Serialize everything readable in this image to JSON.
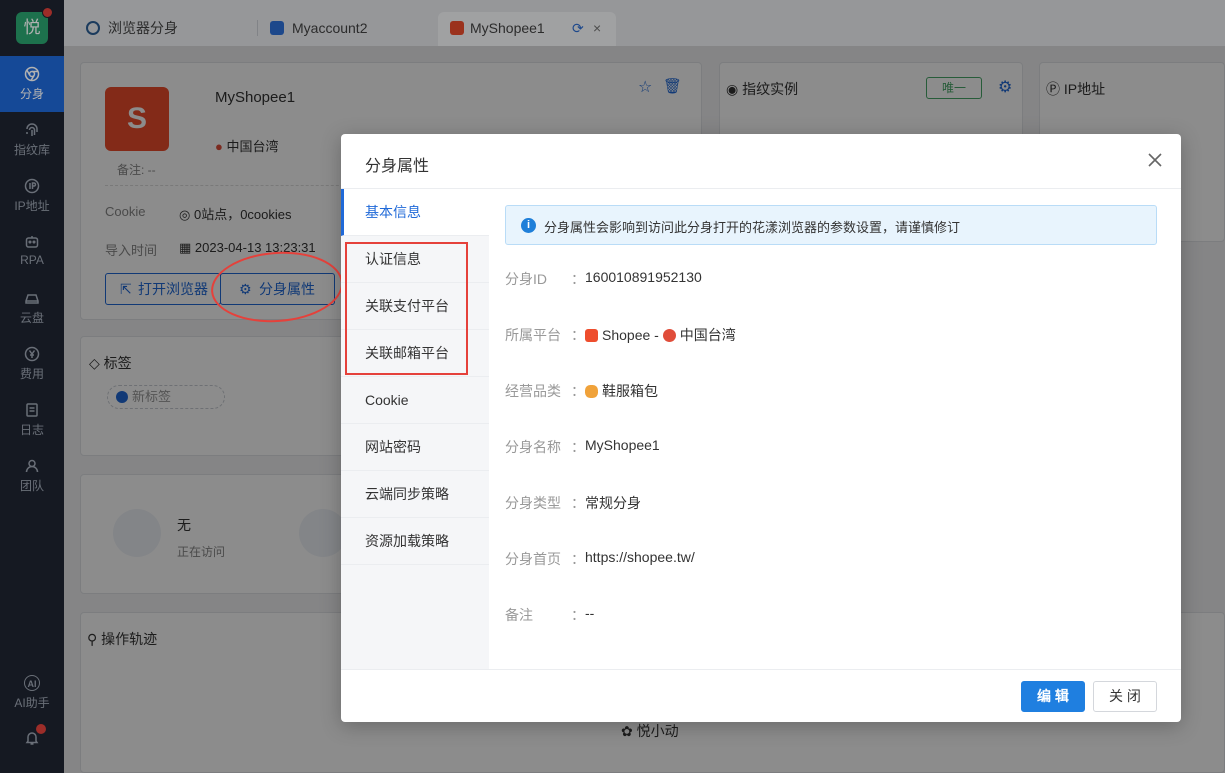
{
  "sidebar": {
    "logo": "悦",
    "items": [
      {
        "label": "分身",
        "icon": "chrome-icon"
      },
      {
        "label": "指纹库",
        "icon": "fingerprint-icon"
      },
      {
        "label": "IP地址",
        "icon": "ip-icon"
      },
      {
        "label": "RPA",
        "icon": "robot-icon"
      },
      {
        "label": "云盘",
        "icon": "cloud-drive-icon"
      },
      {
        "label": "费用",
        "icon": "yen-icon"
      },
      {
        "label": "日志",
        "icon": "log-icon"
      },
      {
        "label": "团队",
        "icon": "team-icon"
      }
    ],
    "ai_label": "AI助手",
    "ai_badge": "AI"
  },
  "tabs": [
    {
      "label": "浏览器分身",
      "icon": "chrome-icon"
    },
    {
      "label": "Myaccount2",
      "icon": "dots-icon"
    },
    {
      "label": "MyShopee1",
      "icon": "shopee-icon"
    }
  ],
  "profile": {
    "name": "MyShopee1",
    "logo_letter": "S",
    "region": "中国台湾",
    "remark": "备注: --",
    "cookie_label": "Cookie",
    "cookie_value": "0站点，0cookies",
    "import_label": "导入时间",
    "import_value": "2023-04-13 13:23:31",
    "open_browser": "打开浏览器",
    "attributes": "分身属性"
  },
  "cards": {
    "fingerprint": "指纹实例",
    "fingerprint_badge": "唯一",
    "ip": "IP地址",
    "tags": "标签",
    "new_tag": "新标签",
    "visitor": "无",
    "visiting": "正在访问",
    "trace": "操作轨迹",
    "assistant": "悦小动"
  },
  "modal": {
    "title": "分身属性",
    "menu": [
      "基本信息",
      "认证信息",
      "关联支付平台",
      "关联邮箱平台",
      "Cookie",
      "网站密码",
      "云端同步策略",
      "资源加载策略"
    ],
    "notice": "分身属性会影响到访问此分身打开的花漾浏览器的参数设置，请谨慎修订",
    "fields": {
      "id_label": "分身ID",
      "id_value": "160010891952130",
      "platform_label": "所属平台",
      "platform_name": "Shopee",
      "platform_sep": "-",
      "platform_region": "中国台湾",
      "category_label": "经营品类",
      "category_value": "鞋服箱包",
      "name_label": "分身名称",
      "name_value": "MyShopee1",
      "type_label": "分身类型",
      "type_value": "常规分身",
      "home_label": "分身首页",
      "home_value": "https://shopee.tw/",
      "remark_label": "备注",
      "remark_value": "--"
    },
    "colon": "：",
    "edit_btn": "编 辑",
    "close_btn": "关 闭"
  },
  "colors": {
    "accent": "#1f69d8",
    "shopee": "#ee4d2d",
    "sidebar_bg": "#1f2531",
    "highlight": "#e5413b"
  }
}
